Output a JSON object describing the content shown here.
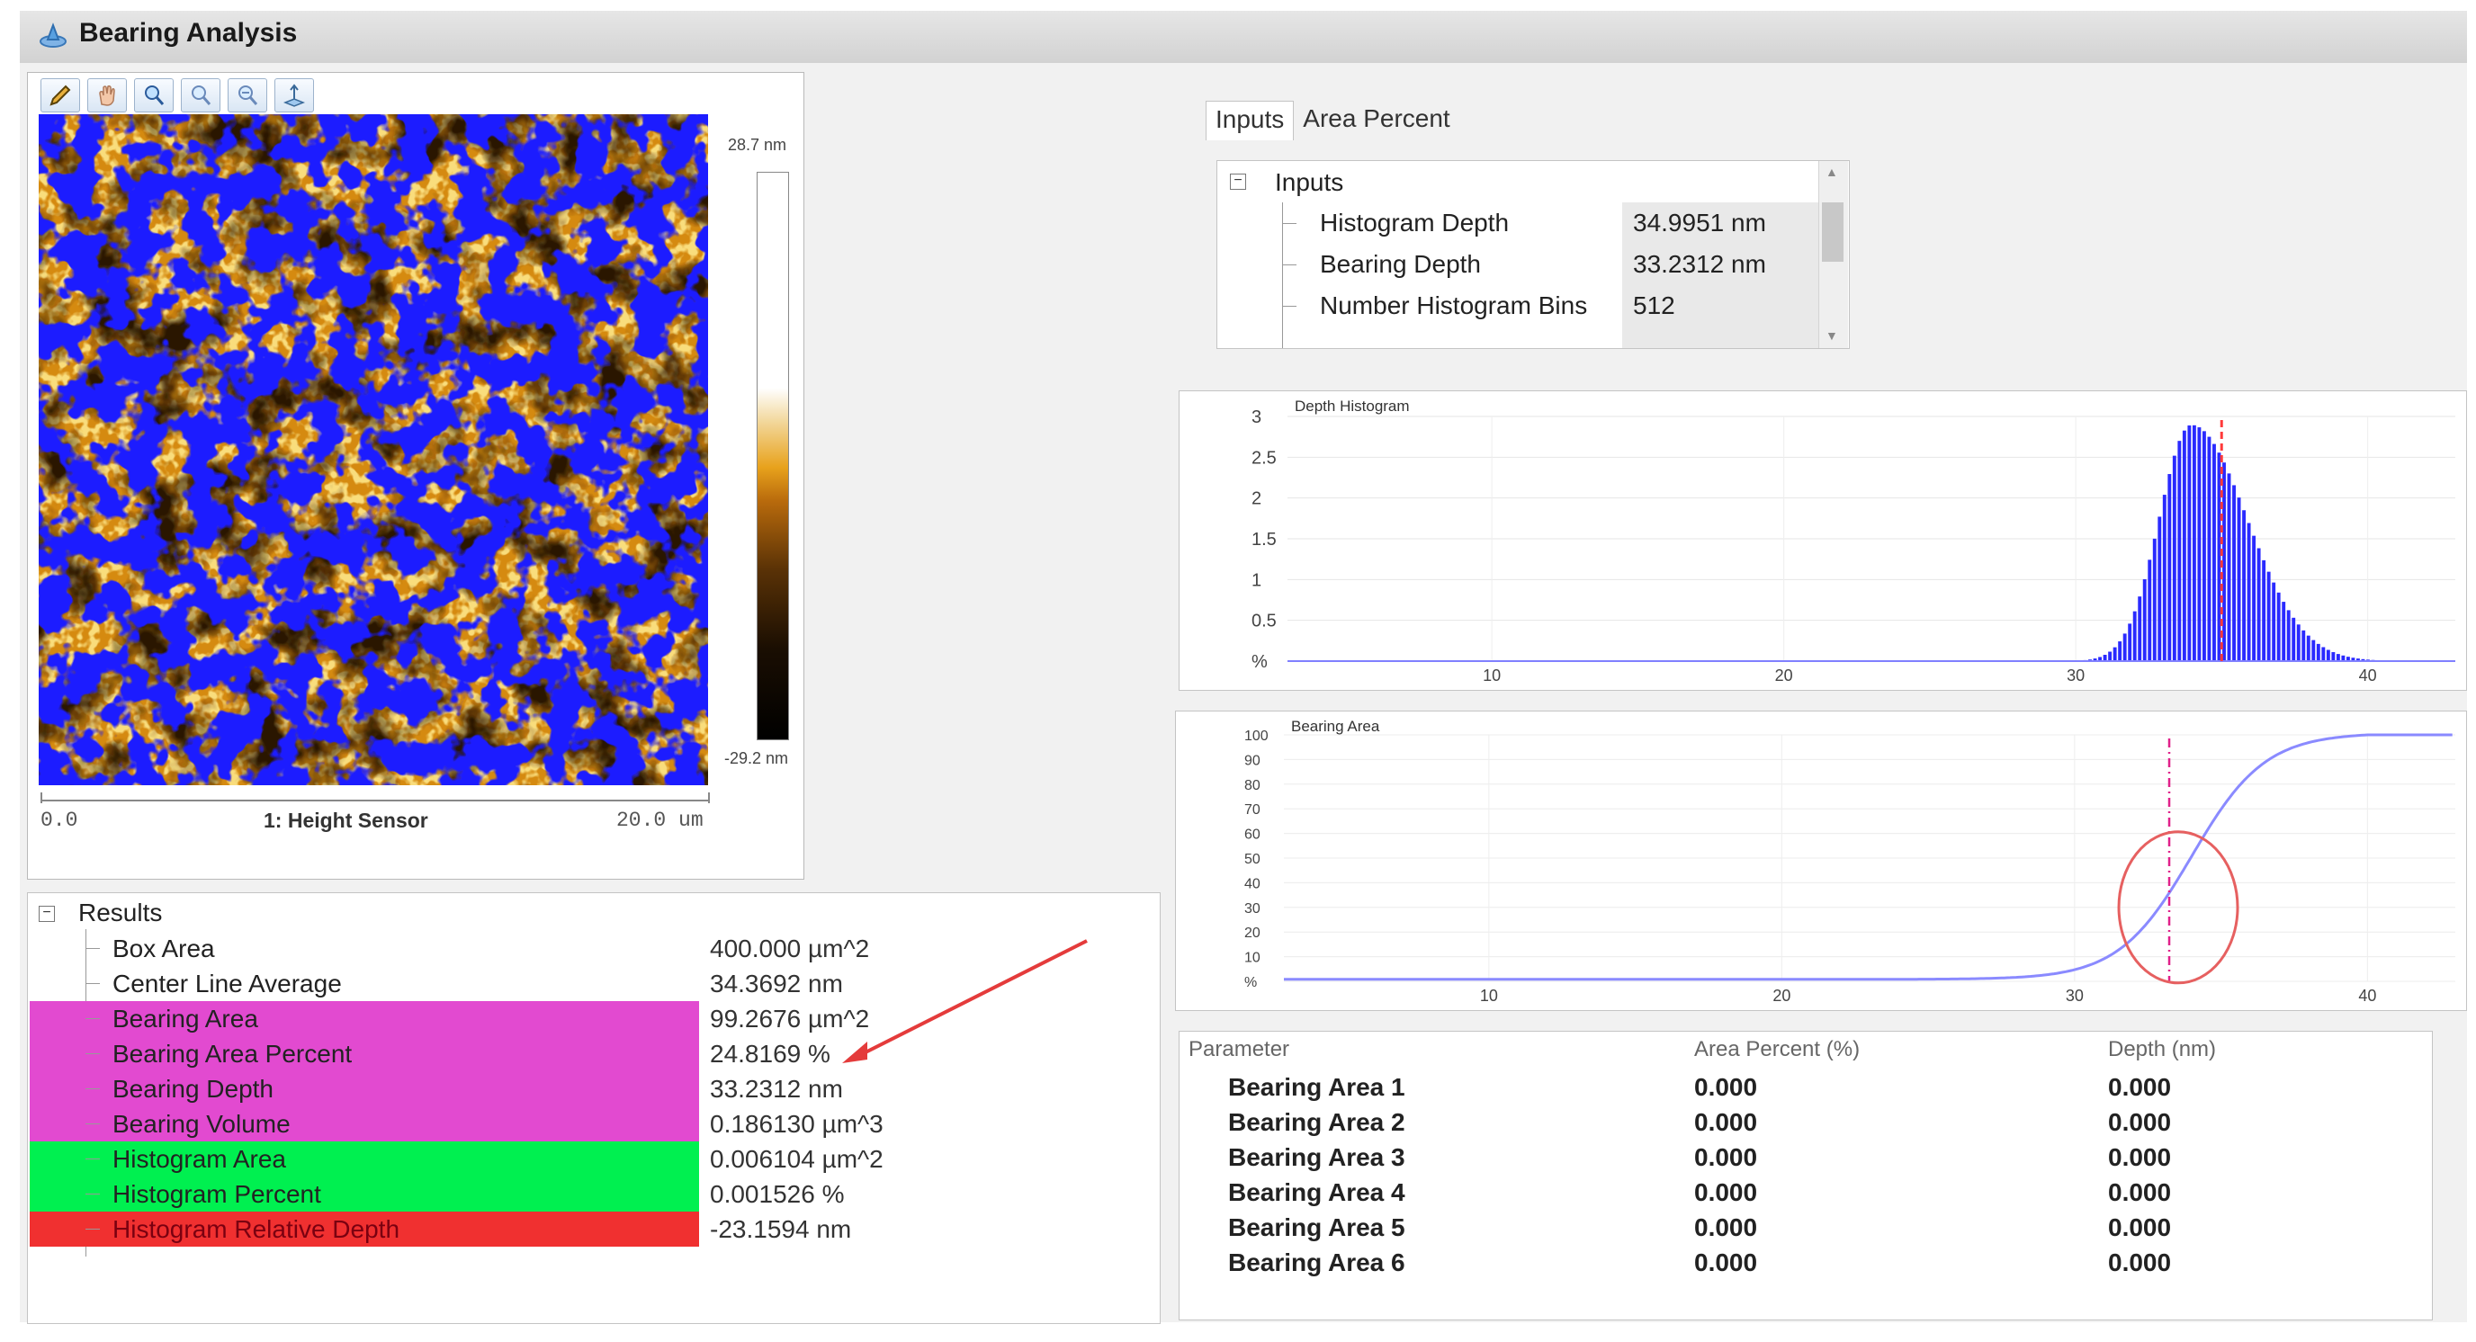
{
  "window": {
    "title": "Bearing Analysis"
  },
  "toolbar": {
    "tools": [
      "pencil-tool-icon",
      "hand-pan-icon",
      "zoom-in-icon",
      "zoom-region-icon",
      "zoom-out-icon",
      "plane-fit-icon"
    ]
  },
  "image_panel": {
    "colorbar_max": "28.7 nm",
    "colorbar_min": "-29.2 nm",
    "scale_min": "0.0",
    "scale_label": "1: Height Sensor",
    "scale_max": "20.0 um",
    "colors": {
      "substrate": "#d58a10",
      "bearing_overlay": "#1b1bff",
      "dark": "#2a1502"
    }
  },
  "results": {
    "header": "Results",
    "rows": [
      {
        "label": "Box Area",
        "value": "400.000 µm^2",
        "highlight": ""
      },
      {
        "label": "Center Line Average",
        "value": "34.3692 nm",
        "highlight": ""
      },
      {
        "label": "Bearing Area",
        "value": "99.2676 µm^2",
        "highlight": "#e24ad0"
      },
      {
        "label": "Bearing Area Percent",
        "value": "24.8169 %",
        "highlight": "#e24ad0"
      },
      {
        "label": "Bearing Depth",
        "value": "33.2312 nm",
        "highlight": "#e24ad0"
      },
      {
        "label": "Bearing Volume",
        "value": "0.186130 µm^3",
        "highlight": "#e24ad0"
      },
      {
        "label": "Histogram Area",
        "value": "0.006104 µm^2",
        "highlight": "#00f050"
      },
      {
        "label": "Histogram Percent",
        "value": "0.001526 %",
        "highlight": "#00f050"
      },
      {
        "label": "Histogram Relative Depth",
        "value": "-23.1594 nm",
        "highlight": "#f03030"
      }
    ]
  },
  "tabs": [
    {
      "label": "Inputs",
      "active": true
    },
    {
      "label": "Area Percent",
      "active": false
    }
  ],
  "inputs": {
    "header": "Inputs",
    "rows": [
      {
        "label": "Histogram Depth",
        "value": "34.9951 nm"
      },
      {
        "label": "Bearing Depth",
        "value": "33.2312 nm"
      },
      {
        "label": "Number Histogram Bins",
        "value": "512"
      }
    ]
  },
  "chart_data": [
    {
      "type": "bar",
      "title": "Depth Histogram",
      "xlabel": "",
      "ylabel": "%",
      "x_ticks": [
        10,
        20,
        30,
        40
      ],
      "y_ticks": [
        "3",
        "2.5",
        "2",
        "1.5",
        "1",
        "0.5",
        "%"
      ],
      "xlim": [
        3,
        43
      ],
      "ylim": [
        0,
        3
      ],
      "peak": {
        "x": 33.9,
        "y": 2.9
      },
      "marker_x": 34.9951,
      "color": "#2a2aff",
      "marker_color": "#ff3b3b"
    },
    {
      "type": "line",
      "title": "Bearing Area",
      "xlabel": "",
      "ylabel": "%",
      "x_ticks": [
        10,
        20,
        30,
        40
      ],
      "y_ticks": [
        "100",
        "90",
        "80",
        "70",
        "60",
        "50",
        "40",
        "30",
        "20",
        "10",
        "%"
      ],
      "xlim": [
        3,
        43
      ],
      "ylim": [
        0,
        100
      ],
      "midpoint_x": 34.0,
      "marker_x": 33.2312,
      "color": "#8a8aff",
      "marker_color": "#e0208a",
      "circle_color": "#e66060"
    }
  ],
  "parameter_table": {
    "headers": [
      "Parameter",
      "Area Percent (%)",
      "Depth (nm)"
    ],
    "rows": [
      {
        "name": "Bearing Area 1",
        "area": "0.000",
        "depth": "0.000"
      },
      {
        "name": "Bearing Area 2",
        "area": "0.000",
        "depth": "0.000"
      },
      {
        "name": "Bearing Area 3",
        "area": "0.000",
        "depth": "0.000"
      },
      {
        "name": "Bearing Area 4",
        "area": "0.000",
        "depth": "0.000"
      },
      {
        "name": "Bearing Area 5",
        "area": "0.000",
        "depth": "0.000"
      },
      {
        "name": "Bearing Area 6",
        "area": "0.000",
        "depth": "0.000"
      }
    ]
  }
}
